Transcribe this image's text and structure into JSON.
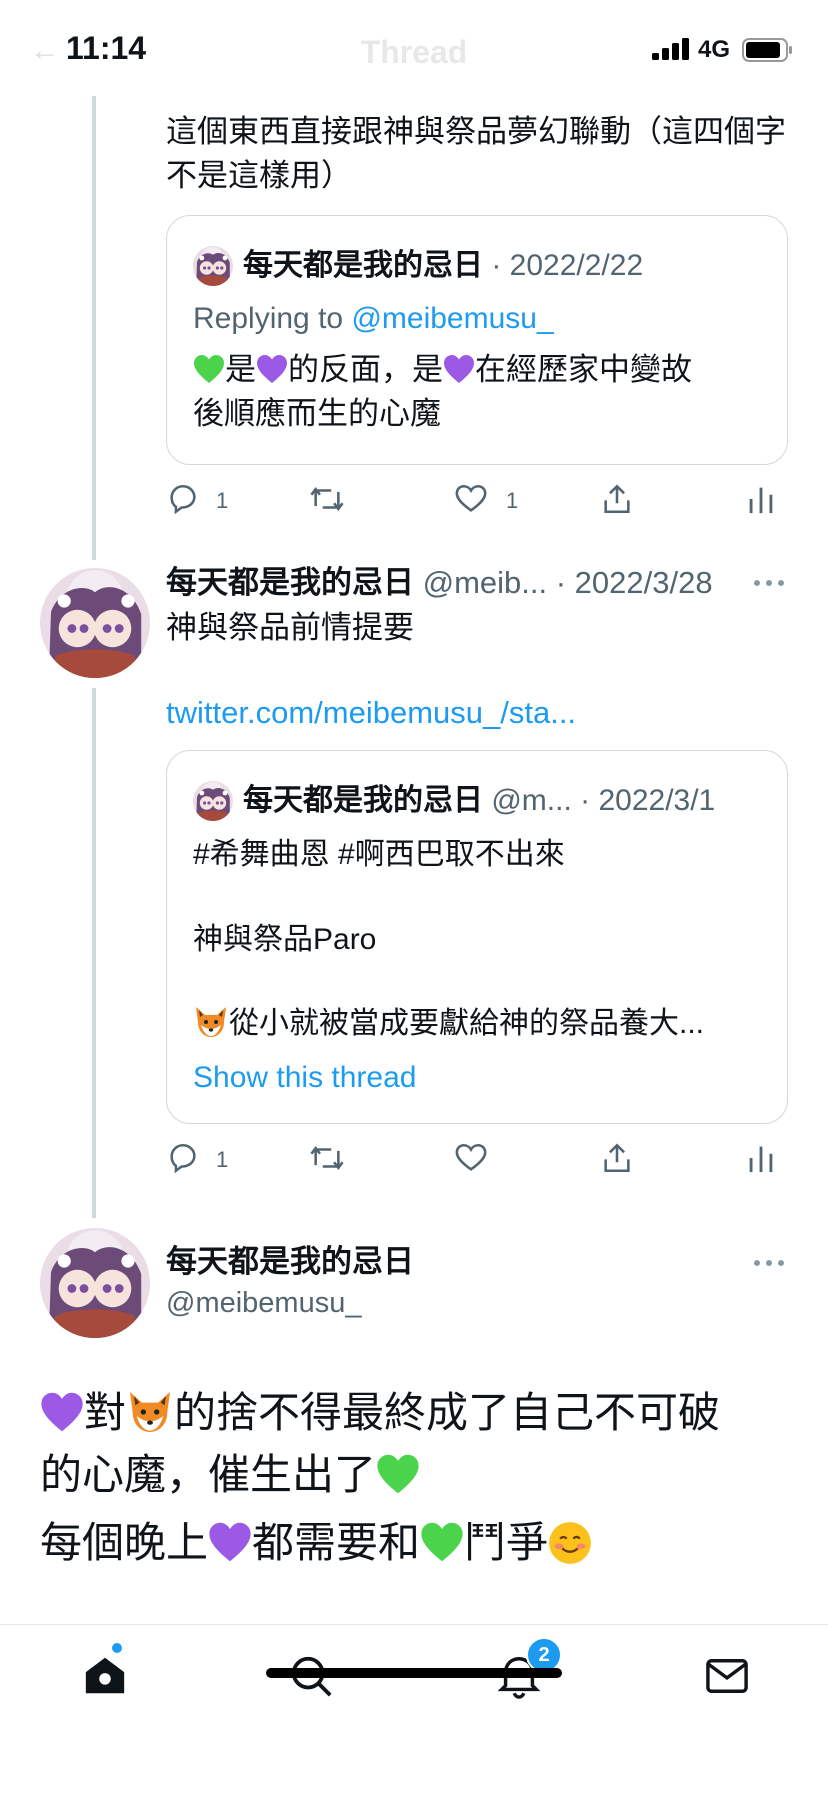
{
  "status_bar": {
    "time": "11:14",
    "network": "4G",
    "nav_title": "Thread"
  },
  "reply_tweet": {
    "text": "這個東西直接跟神與祭品夢幻聯動（這四個字不是這樣用）",
    "quote": {
      "name": "每天都是我的忌日",
      "date": "· 2022/2/22",
      "replying_prefix": "Replying to ",
      "replying_handle": "@meibemusu_",
      "line1_a": "是",
      "line1_b": "的反面，是",
      "line1_c": "在經歷家中變故",
      "line2": "後順應而生的心魔"
    },
    "actions": {
      "reply_count": "1",
      "like_count": "1"
    }
  },
  "tweet2": {
    "name": "每天都是我的忌日",
    "handle": "@meib...",
    "date": "· 2022/3/28",
    "text": "神與祭品前情提要",
    "link": "twitter.com/meibemusu_/sta...",
    "quote": {
      "name": "每天都是我的忌日",
      "handle": "@m...",
      "date": "· 2022/3/1",
      "hashtags": "#希舞曲恩 #啊西巴取不出來",
      "line2": "神與祭品Paro",
      "line3": "從小就被當成要獻給神的祭品養大...",
      "show_thread": "Show this thread"
    },
    "actions": {
      "reply_count": "1"
    }
  },
  "main_tweet": {
    "name": "每天都是我的忌日",
    "handle": "@meibemusu_",
    "p1_a": "對",
    "p1_b": "的捨不得最終成了自己不可破",
    "p1_c": "的心魔，催生出了",
    "p2_a": "每個晚上",
    "p2_b": "都需要和",
    "p2_c": "鬥爭"
  },
  "tab_bar": {
    "notifications_badge": "2"
  },
  "icons": [
    "home-icon",
    "search-icon",
    "bell-icon",
    "mail-icon",
    "reply-icon",
    "retweet-icon",
    "like-icon",
    "share-icon",
    "analytics-icon",
    "more-icon"
  ],
  "colors": {
    "link": "#1d9bf0",
    "gray": "#536471",
    "border": "#cfd9de",
    "purple_heart": "#9b59e6",
    "green_heart": "#4cd34c"
  }
}
